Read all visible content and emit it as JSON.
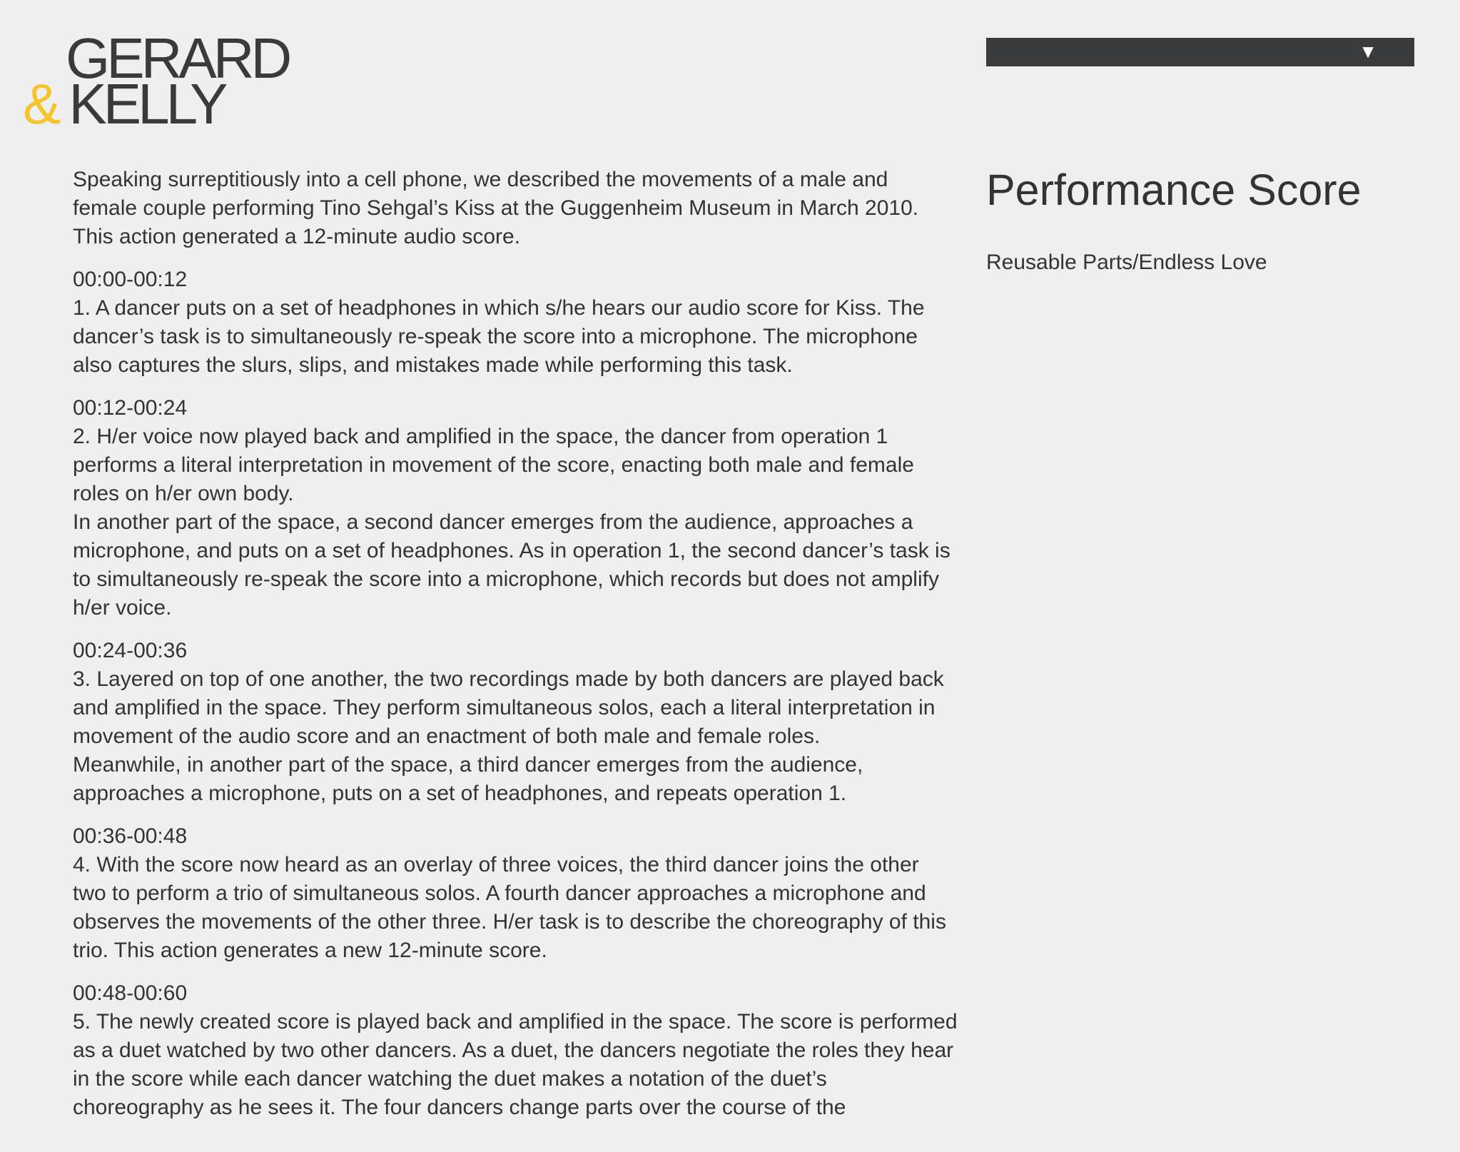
{
  "logo": {
    "line1": "GERARD",
    "ampersand": "&",
    "line2": "KELLY",
    "accent_color": "#f5c32c"
  },
  "nav": {
    "toggle_icon": "▼",
    "bar_color": "#3a3b3c"
  },
  "sidebar": {
    "title": "Performance Score",
    "link": "Reusable Parts/Endless Love"
  },
  "main": {
    "intro": "Speaking surreptitiously into a cell phone, we described the movements of a male and female couple performing Tino Sehgal’s Kiss at the Guggenheim Museum in March 2010. This action generated a 12-minute audio score.",
    "sections": [
      {
        "time": "00:00-00:12",
        "paragraphs": [
          "1. A dancer puts on a set of headphones in which s/he hears our audio score for Kiss. The dancer’s task is to simultaneously re-speak the score into a microphone. The microphone also captures the slurs, slips, and mistakes made while performing this task."
        ]
      },
      {
        "time": "00:12-00:24",
        "paragraphs": [
          "2. H/er voice now played back and amplified in the space, the dancer from operation 1 performs a literal interpretation in movement of the score, enacting both male and female roles on h/er own body.",
          "In another part of the space, a second dancer emerges from the audience, approaches a microphone, and puts on a set of headphones. As in operation 1, the second dancer’s task is to simultaneously re-speak the score into a microphone, which records but does not amplify h/er voice."
        ]
      },
      {
        "time": "00:24-00:36",
        "paragraphs": [
          "3. Layered on top of one another, the two recordings made by both dancers are played back and amplified in the space. They perform simultaneous solos, each a literal interpretation in movement of the audio score and an enactment of both male and female roles.",
          "Meanwhile, in another part of the space, a third dancer emerges from the audience, approaches a microphone, puts on a set of headphones, and repeats operation 1."
        ]
      },
      {
        "time": "00:36-00:48",
        "paragraphs": [
          "4. With the score now heard as an overlay of three voices, the third dancer joins the other two to perform a trio of simultaneous solos. A fourth dancer approaches a microphone and observes the movements of the other three. H/er task is to describe the choreography of this trio. This action generates a new 12-minute score."
        ]
      },
      {
        "time": "00:48-00:60",
        "paragraphs": [
          "5. The newly created score is played back and amplified in the space. The score is performed as a duet watched by two other dancers. As a duet, the dancers negotiate the roles they hear in the score while each dancer watching the duet makes a notation of the duet’s choreography as he sees it. The four dancers change parts over the course of the"
        ]
      }
    ]
  }
}
